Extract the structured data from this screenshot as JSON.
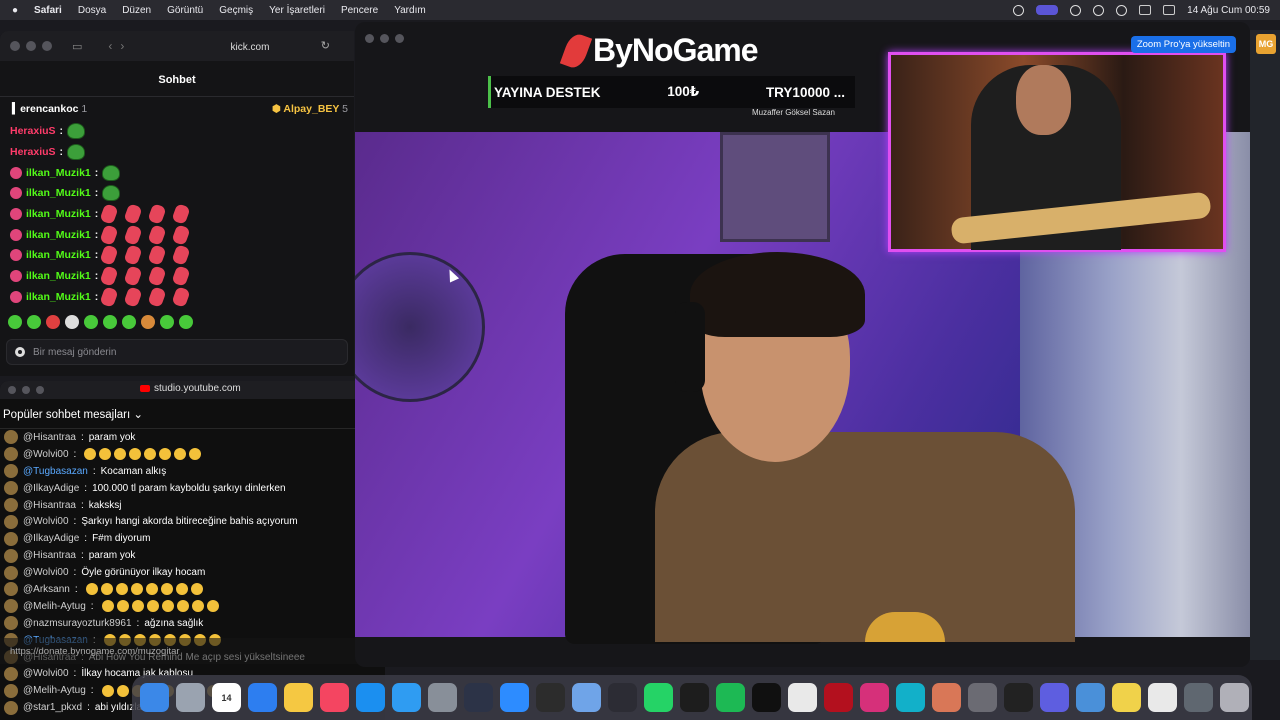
{
  "menubar": {
    "app": "Safari",
    "items": [
      "Dosya",
      "Düzen",
      "Görüntü",
      "Geçmiş",
      "Yer İşaretleri",
      "Pencere",
      "Yardım"
    ],
    "datetime": "14 Ağu Cum  00:59"
  },
  "safari": {
    "url": "kick.com",
    "chat_title": "Sohbet",
    "pinned_left_user": "erencankoc",
    "pinned_left_count": "1",
    "pinned_right_user": "Alpay_BEY",
    "pinned_right_count": "5",
    "messages": [
      {
        "user": "HeraxiuS",
        "sep": ":",
        "type": "red"
      },
      {
        "user": "HeraxiuS",
        "sep": ":",
        "type": "red"
      },
      {
        "user": "ilkan_Muzik1",
        "sep": ":",
        "type": "green"
      },
      {
        "user": "ilkan_Muzik1",
        "sep": ":",
        "type": "green"
      },
      {
        "user": "ilkan_Muzik1",
        "sep": ":",
        "type": "green"
      },
      {
        "user": "ilkan_Muzik1",
        "sep": ":",
        "type": "green"
      },
      {
        "user": "ilkan_Muzik1",
        "sep": ":",
        "type": "green"
      },
      {
        "user": "ilkan_Muzik1",
        "sep": ":",
        "type": "green"
      },
      {
        "user": "ilkan_Muzik1",
        "sep": ":",
        "type": "green"
      }
    ],
    "input_placeholder": "Bir mesaj gönderin"
  },
  "youtube": {
    "url": "studio.youtube.com",
    "header": "Popüler sohbet mesajları",
    "messages": [
      {
        "author": "@Hisantraa",
        "text": "param yok",
        "blue": false
      },
      {
        "author": "@Wolvi00",
        "text": "",
        "blue": false
      },
      {
        "author": "@Tugbasazan",
        "text": "Kocaman alkış",
        "blue": true
      },
      {
        "author": "@IlkayAdige",
        "text": "100.000 tl param kayboldu şarkıyı dinlerken",
        "blue": false
      },
      {
        "author": "@Hisantraa",
        "text": "kaksksj",
        "blue": false
      },
      {
        "author": "@Wolvi00",
        "text": "Şarkıyı hangi akorda bitireceğine bahis açıyorum",
        "blue": false
      },
      {
        "author": "@IlkayAdige",
        "text": "F#m diyorum",
        "blue": false
      },
      {
        "author": "@Hisantraa",
        "text": "param yok",
        "blue": false
      },
      {
        "author": "@Wolvi00",
        "text": "Öyle görünüyor ilkay hocam",
        "blue": false
      },
      {
        "author": "@Arksann",
        "text": "",
        "blue": false
      },
      {
        "author": "@Melih-Aytug",
        "text": "",
        "blue": false
      },
      {
        "author": "@nazmsurayozturk8961",
        "text": "ağzına sağlık",
        "blue": false
      },
      {
        "author": "@Tugbasazan",
        "text": "",
        "blue": true
      },
      {
        "author": "@Hisantraa",
        "text": "Abi How You Remind Me açıp sesi yükseltsineee",
        "blue": false
      },
      {
        "author": "@Wolvi00",
        "text": "İlkay hocama jak kablosu",
        "blue": false
      },
      {
        "author": "@Melih-Aytug",
        "text": "",
        "blue": false
      },
      {
        "author": "@star1_pkxd",
        "text": "abi yıldızlar",
        "blue": false
      }
    ],
    "pinned_text": "https://donate.bynogame.com/muzogitar"
  },
  "stream": {
    "brand": "ByNoGame",
    "donate_label": "YAYINA DESTEK",
    "donate_amount": "100₺",
    "donate_currency": "TRY10000 ...",
    "donor_name": "Muzaffer Göksel Sazan",
    "zoom_button": "Zoom Pro'ya yükseltin",
    "avatar_initials": "MG"
  },
  "dock": {
    "items": [
      "Finder",
      "Launchpad",
      "Calendar",
      "Safari",
      "Notes",
      "Music",
      "App Store",
      "Proxyman",
      "Settings",
      "Streamer",
      "Zoom",
      "OBS",
      "Preview",
      "Final Cut",
      "WhatsApp",
      "ChatGPT",
      "Spotify",
      "CapCut",
      "Chrome",
      "Acrobat",
      "Instagram",
      "Canva",
      "Claude",
      "OBS2",
      "Logic",
      "Apps",
      "Finder2",
      "Notes2",
      "Chrome2",
      "Photos",
      "Trash"
    ],
    "calendar_day": "14",
    "colors": [
      "#3b88e8",
      "#9aa3b0",
      "#ffffff",
      "#2d7ef0",
      "#f5c842",
      "#f44561",
      "#1b8ff0",
      "#2f9cf2",
      "#888f99",
      "#2c3347",
      "#2d8cff",
      "#2c2c2c",
      "#6fa4e8",
      "#2c2c34",
      "#25d366",
      "#1d1d1d",
      "#1db954",
      "#101010",
      "#e9e9e9",
      "#b3101e",
      "#d6307a",
      "#12b0c9",
      "#d97757",
      "#6b6b73",
      "#222222",
      "#5e5ee0",
      "#4a90d9",
      "#f0d24a",
      "#e9e9e9",
      "#5f6770",
      "#b0b0b8"
    ]
  }
}
